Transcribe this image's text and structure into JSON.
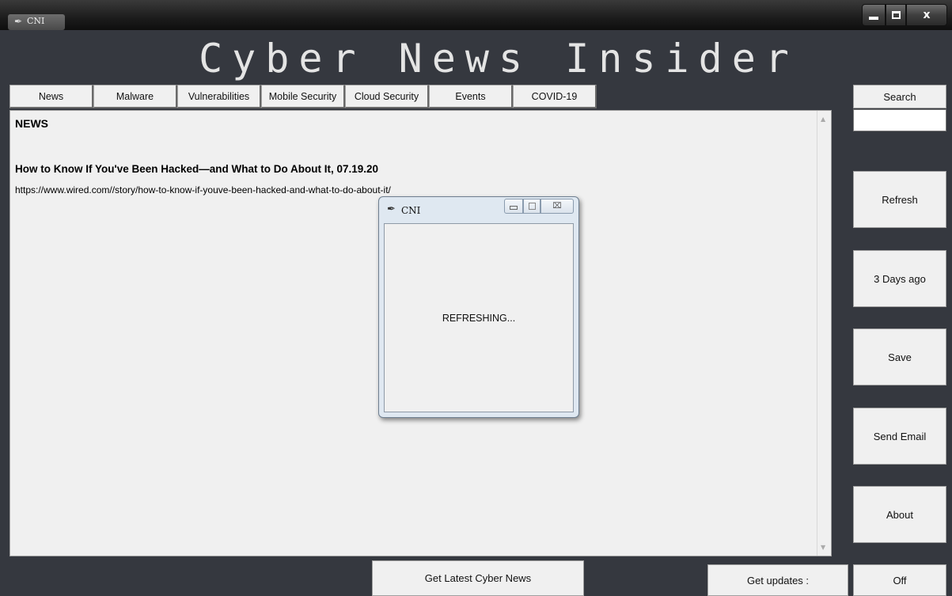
{
  "window": {
    "title": "CNI",
    "controls": {
      "minimize": "",
      "maximize": "",
      "close": "x"
    }
  },
  "app": {
    "title": "Cyber News Insider"
  },
  "tabs": [
    {
      "label": "News"
    },
    {
      "label": "Malware"
    },
    {
      "label": "Vulnerabilities"
    },
    {
      "label": "Mobile Security"
    },
    {
      "label": "Cloud Security"
    },
    {
      "label": "Events"
    },
    {
      "label": "COVID-19"
    }
  ],
  "content": {
    "heading": "NEWS",
    "articles": [
      {
        "title": "How to Know If You've Been Hacked—and What to Do About It, 07.19.20",
        "url": "https://www.wired.com//story/how-to-know-if-youve-been-hacked-and-what-to-do-about-it/"
      }
    ]
  },
  "sidebar": {
    "search_label": "Search",
    "search_value": "",
    "refresh_label": "Refresh",
    "days_ago_label": "3 Days ago",
    "save_label": "Save",
    "send_email_label": "Send Email",
    "about_label": "About"
  },
  "bottom": {
    "get_latest_label": "Get Latest Cyber News",
    "get_updates_label": "Get updates :",
    "toggle_label": "Off"
  },
  "popup": {
    "title": "CNI",
    "message": "REFRESHING..."
  },
  "colors": {
    "background": "#35383f",
    "panel": "#f0f0f0",
    "title_text": "#e4e4e4"
  }
}
